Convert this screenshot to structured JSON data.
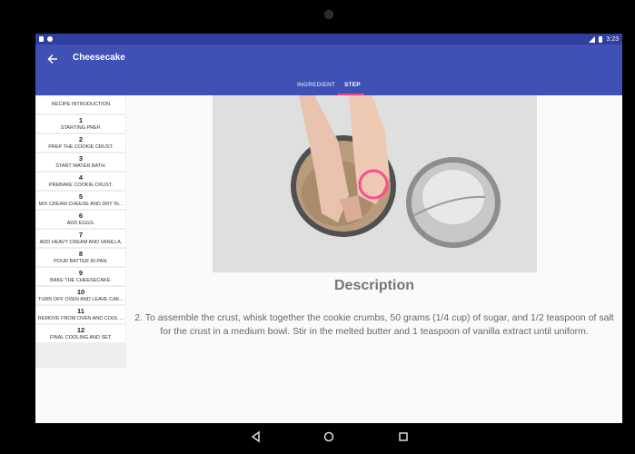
{
  "status_bar": {
    "time": "3:23"
  },
  "app_bar": {
    "title": "Cheesecake",
    "back_icon": "arrow-left-icon"
  },
  "tabs": [
    {
      "label": "INGREDIENT",
      "selected": false
    },
    {
      "label": "STEP",
      "selected": true
    }
  ],
  "steps": {
    "intro_label": "RECIPE INTRODUCTION",
    "items": [
      {
        "number": "1",
        "label": "STARTING PREP."
      },
      {
        "number": "2",
        "label": "PREP THE COOKIE CRUST."
      },
      {
        "number": "3",
        "label": "START WATER BATH."
      },
      {
        "number": "4",
        "label": "PREBAKE COOKIE CRUST."
      },
      {
        "number": "5",
        "label": "MIX CREAM CHEESE AND DRY IN..."
      },
      {
        "number": "6",
        "label": "ADD EGGS."
      },
      {
        "number": "7",
        "label": "ADD HEAVY CREAM AND VANILLA."
      },
      {
        "number": "8",
        "label": "POUR BATTER IN PAN."
      },
      {
        "number": "9",
        "label": "BAKE THE CHEESECAKE."
      },
      {
        "number": "10",
        "label": "TURN OFF OVEN AND LEAVE CAK..."
      },
      {
        "number": "11",
        "label": "REMOVE FROM OVEN AND COOL ..."
      },
      {
        "number": "12",
        "label": "FINAL COOLING AND SET."
      }
    ]
  },
  "description": {
    "heading": "Description",
    "text": "2. To assemble the crust, whisk together the cookie crumbs, 50 grams (1/4 cup) of sugar, and 1/2 teaspoon of salt for the crust in a medium bowl. Stir in the melted butter and 1 teaspoon of vanilla extract until uniform."
  },
  "colors": {
    "status_bar": "#303f9f",
    "app_bar": "#3f51b5",
    "tab_indicator": "#ff4081"
  }
}
